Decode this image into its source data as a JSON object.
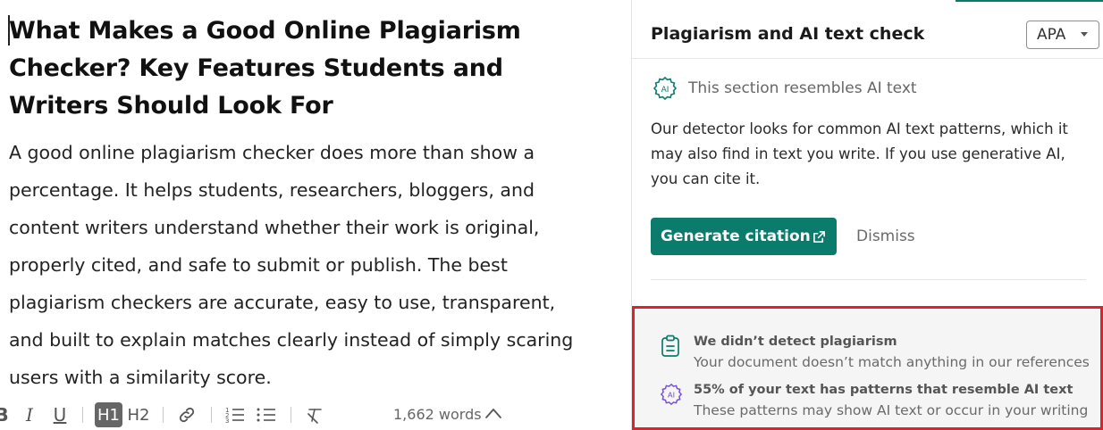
{
  "editor": {
    "title": "What Makes a Good Online Plagiarism Checker? Key Features Students and Writers Should Look For",
    "body": "A good online plagiarism checker does more than show a percentage. It helps students, researchers, bloggers, and content writers understand whether their work is original, properly cited, and safe to submit or publish. The best plagiarism checkers are accurate, easy to use, transparent, and built to explain matches clearly instead of simply scaring users with a similarity score."
  },
  "toolbar": {
    "buttons": [
      {
        "name": "bold",
        "icon": "bold-icon",
        "label": "B"
      },
      {
        "name": "italic",
        "icon": "italic-icon",
        "label": "I"
      },
      {
        "name": "underline",
        "icon": "underline-icon",
        "label": "U"
      },
      {
        "name": "heading1",
        "icon": "h1-icon",
        "label": "H1",
        "active": true
      },
      {
        "name": "heading2",
        "icon": "h2-icon",
        "label": "H2"
      },
      {
        "name": "link",
        "icon": "link-icon"
      },
      {
        "name": "numbered-list",
        "icon": "numbered-list-icon"
      },
      {
        "name": "bulleted-list",
        "icon": "bulleted-list-icon"
      },
      {
        "name": "clear-formatting",
        "icon": "clear-formatting-icon"
      }
    ],
    "word_count": "1,662 words",
    "word_count_toggle_icon": "chevron-up-icon"
  },
  "panel": {
    "title": "Plagiarism and AI text check",
    "citation_style": {
      "selected": "APA",
      "icon": "caret-down-icon"
    },
    "ai_notice": {
      "icon": "ai-badge-icon",
      "label": "This section resembles AI text"
    },
    "description": "Our detector looks for common AI text patterns, which it may also find in text you write. If you use generative AI, you can cite it.",
    "generate_citation_label": "Generate citation",
    "generate_citation_icon": "external-link-icon",
    "dismiss_label": "Dismiss",
    "summary": [
      {
        "icon": "clipboard-icon",
        "title": "We didn’t detect plagiarism",
        "subtitle": "Your document doesn’t match anything in our references"
      },
      {
        "icon": "ai-badge-icon",
        "title": "55% of your text has patterns that resemble AI text",
        "subtitle": "These patterns may show AI text or occur in your writing"
      }
    ]
  },
  "colors": {
    "accent": "#0b7c6c",
    "highlight_border": "#d9232d",
    "summary_bg": "#f5f5f5",
    "ai_icon": "#7a4fd6"
  }
}
